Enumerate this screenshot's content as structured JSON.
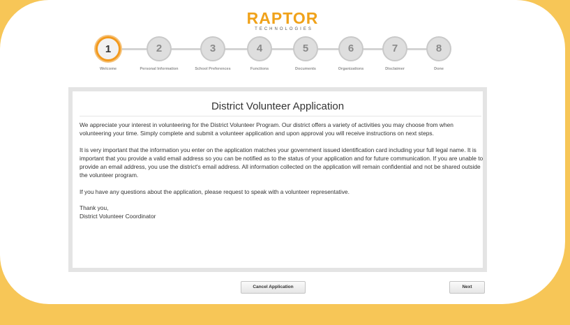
{
  "brand": {
    "name": "RAPTOR",
    "tagline": "TECHNOLOGIES"
  },
  "steps": [
    {
      "number": "1",
      "label": "Welcome"
    },
    {
      "number": "2",
      "label": "Personal Information"
    },
    {
      "number": "3",
      "label": "School Preferences"
    },
    {
      "number": "4",
      "label": "Functions"
    },
    {
      "number": "5",
      "label": "Documents"
    },
    {
      "number": "6",
      "label": "Organizations"
    },
    {
      "number": "7",
      "label": "Disclaimer"
    },
    {
      "number": "8",
      "label": "Done"
    }
  ],
  "active_step": 1,
  "content": {
    "title": "District Volunteer Application",
    "paragraphs": [
      "We appreciate your interest in volunteering for the District Volunteer Program. Our district offers a variety of activities you may choose from when volunteering your time. Simply complete and submit a volunteer application and upon approval you will receive instructions on next steps.",
      "It is very important that the information you enter on the application matches your government issued identification card including your full legal name. It is important that you provide a valid email address so you can be notified as to the status of your application and for future communication. If you are unable to provide an email address, you use the district's email address. All information collected on the application will remain confidential and not be shared outside the volunteer program.",
      "If you have any questions about the application, please request to speak with a volunteer representative."
    ],
    "signoff": "Thank you,",
    "signature": "District Volunteer Coordinator"
  },
  "buttons": {
    "cancel": "Cancel Application",
    "next": "Next"
  },
  "colors": {
    "background": "#f7c657",
    "accent": "#f39a1e",
    "brand": "#f0a21a"
  }
}
